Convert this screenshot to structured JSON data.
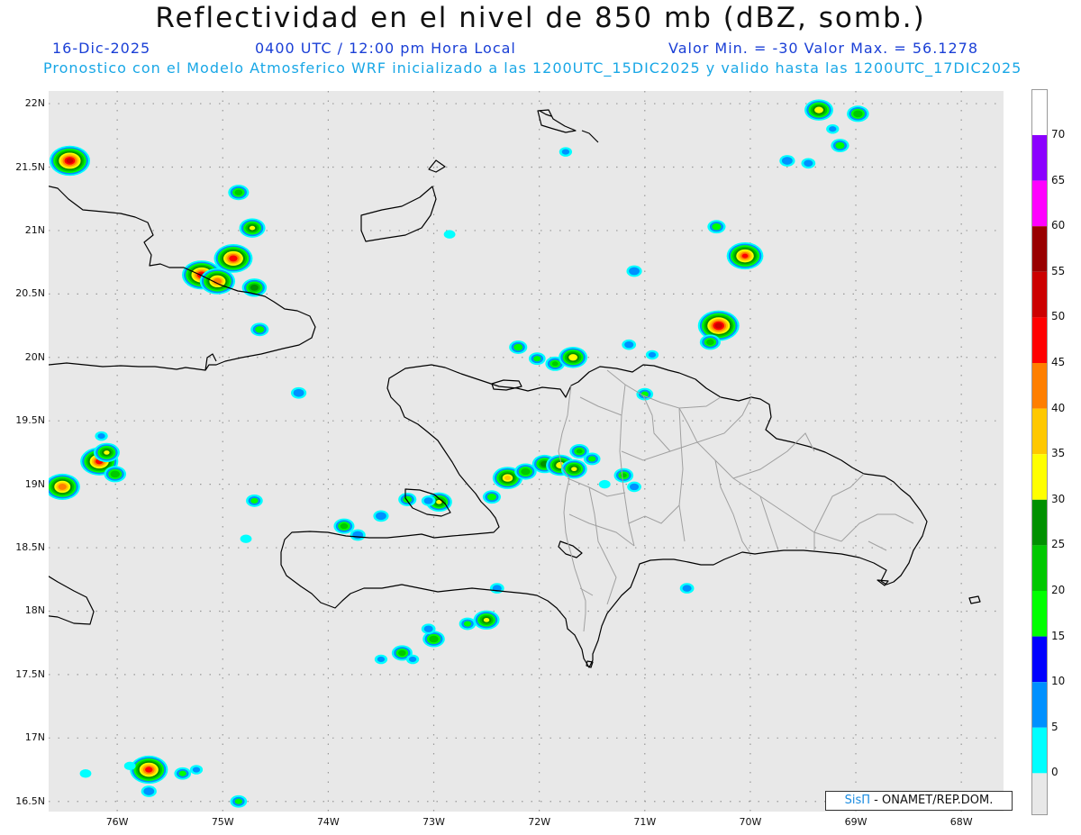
{
  "title": "Reflectividad en el nivel de 850 mb (dBZ, somb.)",
  "date": "16-Dic-2025",
  "time": "0400 UTC / 12:00 pm Hora Local",
  "min_max": "Valor Min. = -30  Valor Max. = 56.1278",
  "subtitle": "Pronostico con el Modelo Atmosferico WRF inicializado a las 1200UTC_15DIC2025 y valido hasta las  1200UTC_17DIC2025",
  "credit": {
    "logo": "SisΠ",
    "text": " - ONAMET/REP.DOM."
  },
  "map": {
    "lon_range": [
      -76.65,
      -67.6
    ],
    "lat_range": [
      16.42,
      22.1
    ],
    "lon_labels": [
      "76W",
      "75W",
      "74W",
      "73W",
      "72W",
      "71W",
      "70W",
      "69W",
      "68W"
    ],
    "lat_labels": [
      "22N",
      "21.5N",
      "21N",
      "20.5N",
      "20N",
      "19.5N",
      "19N",
      "18.5N",
      "18N",
      "17.5N",
      "17N",
      "16.5N"
    ],
    "background_color": "#e8e8e8",
    "coast_color": "#000000",
    "province_color": "#a0a0a0",
    "echoes": [
      {
        "lon": -76.45,
        "lat": 21.55,
        "peak": 52
      },
      {
        "lon": -75.2,
        "lat": 20.65,
        "peak": 50
      },
      {
        "lon": -74.9,
        "lat": 20.78,
        "peak": 49
      },
      {
        "lon": -75.05,
        "lat": 20.6,
        "peak": 44
      },
      {
        "lon": -74.72,
        "lat": 21.02,
        "peak": 30
      },
      {
        "lon": -74.7,
        "lat": 20.55,
        "peak": 28
      },
      {
        "lon": -74.85,
        "lat": 21.3,
        "peak": 22
      },
      {
        "lon": -74.65,
        "lat": 20.22,
        "peak": 18
      },
      {
        "lon": -74.28,
        "lat": 19.72,
        "peak": 14
      },
      {
        "lon": -76.17,
        "lat": 19.18,
        "peak": 48
      },
      {
        "lon": -76.1,
        "lat": 19.25,
        "peak": 30
      },
      {
        "lon": -76.02,
        "lat": 19.08,
        "peak": 24
      },
      {
        "lon": -76.52,
        "lat": 18.98,
        "peak": 44
      },
      {
        "lon": -76.15,
        "lat": 19.38,
        "peak": 10
      },
      {
        "lon": -74.7,
        "lat": 18.87,
        "peak": 16
      },
      {
        "lon": -74.78,
        "lat": 18.57,
        "peak": 8
      },
      {
        "lon": -70.3,
        "lat": 20.25,
        "peak": 53
      },
      {
        "lon": -70.05,
        "lat": 20.8,
        "peak": 46
      },
      {
        "lon": -70.38,
        "lat": 20.12,
        "peak": 22
      },
      {
        "lon": -70.32,
        "lat": 21.03,
        "peak": 18
      },
      {
        "lon": -69.35,
        "lat": 21.95,
        "peak": 34
      },
      {
        "lon": -68.98,
        "lat": 21.92,
        "peak": 24
      },
      {
        "lon": -69.15,
        "lat": 21.67,
        "peak": 18
      },
      {
        "lon": -69.65,
        "lat": 21.55,
        "peak": 14
      },
      {
        "lon": -69.45,
        "lat": 21.53,
        "peak": 12
      },
      {
        "lon": -69.22,
        "lat": 21.8,
        "peak": 10
      },
      {
        "lon": -71.1,
        "lat": 20.68,
        "peak": 14
      },
      {
        "lon": -71.15,
        "lat": 20.1,
        "peak": 12
      },
      {
        "lon": -70.93,
        "lat": 20.02,
        "peak": 10
      },
      {
        "lon": -71.75,
        "lat": 21.62,
        "peak": 10
      },
      {
        "lon": -72.85,
        "lat": 20.97,
        "peak": 8
      },
      {
        "lon": -72.2,
        "lat": 20.08,
        "peak": 18
      },
      {
        "lon": -72.02,
        "lat": 19.99,
        "peak": 16
      },
      {
        "lon": -71.85,
        "lat": 19.95,
        "peak": 20
      },
      {
        "lon": -71.68,
        "lat": 20.0,
        "peak": 34
      },
      {
        "lon": -71.0,
        "lat": 19.71,
        "peak": 16
      },
      {
        "lon": -72.3,
        "lat": 19.05,
        "peak": 36
      },
      {
        "lon": -72.13,
        "lat": 19.1,
        "peak": 24
      },
      {
        "lon": -72.45,
        "lat": 18.9,
        "peak": 18
      },
      {
        "lon": -71.95,
        "lat": 19.16,
        "peak": 28
      },
      {
        "lon": -71.8,
        "lat": 19.15,
        "peak": 34
      },
      {
        "lon": -71.67,
        "lat": 19.12,
        "peak": 30
      },
      {
        "lon": -71.62,
        "lat": 19.26,
        "peak": 20
      },
      {
        "lon": -71.5,
        "lat": 19.2,
        "peak": 16
      },
      {
        "lon": -71.2,
        "lat": 19.07,
        "peak": 20
      },
      {
        "lon": -71.38,
        "lat": 19.0,
        "peak": 8
      },
      {
        "lon": -71.1,
        "lat": 18.98,
        "peak": 12
      },
      {
        "lon": -72.95,
        "lat": 18.86,
        "peak": 30
      },
      {
        "lon": -73.25,
        "lat": 18.88,
        "peak": 18
      },
      {
        "lon": -73.05,
        "lat": 18.87,
        "peak": 12
      },
      {
        "lon": -73.5,
        "lat": 18.75,
        "peak": 14
      },
      {
        "lon": -73.85,
        "lat": 18.67,
        "peak": 22
      },
      {
        "lon": -73.72,
        "lat": 18.6,
        "peak": 14
      },
      {
        "lon": -72.5,
        "lat": 17.93,
        "peak": 30
      },
      {
        "lon": -72.68,
        "lat": 17.9,
        "peak": 16
      },
      {
        "lon": -72.4,
        "lat": 18.18,
        "peak": 12
      },
      {
        "lon": -73.0,
        "lat": 17.78,
        "peak": 24
      },
      {
        "lon": -73.05,
        "lat": 17.86,
        "peak": 12
      },
      {
        "lon": -73.3,
        "lat": 17.67,
        "peak": 22
      },
      {
        "lon": -73.2,
        "lat": 17.62,
        "peak": 10
      },
      {
        "lon": -73.5,
        "lat": 17.62,
        "peak": 10
      },
      {
        "lon": -70.6,
        "lat": 18.18,
        "peak": 12
      },
      {
        "lon": -75.7,
        "lat": 16.75,
        "peak": 48
      },
      {
        "lon": -75.88,
        "lat": 16.78,
        "peak": 8
      },
      {
        "lon": -75.7,
        "lat": 16.58,
        "peak": 14
      },
      {
        "lon": -75.38,
        "lat": 16.72,
        "peak": 16
      },
      {
        "lon": -75.25,
        "lat": 16.75,
        "peak": 10
      },
      {
        "lon": -76.3,
        "lat": 16.72,
        "peak": 8
      },
      {
        "lon": -74.85,
        "lat": 16.5,
        "peak": 16
      }
    ]
  },
  "colorbar": {
    "labels": [
      "70",
      "65",
      "60",
      "55",
      "50",
      "45",
      "40",
      "35",
      "30",
      "25",
      "20",
      "15",
      "10",
      "5",
      "0"
    ],
    "colors": [
      "#8b00ff",
      "#ff00ff",
      "#990000",
      "#cc0000",
      "#ff0000",
      "#ff7f00",
      "#ffc800",
      "#ffff00",
      "#009000",
      "#00c800",
      "#00ff00",
      "#0000ff",
      "#0090ff",
      "#00ffff",
      "#e8e8e8"
    ]
  }
}
